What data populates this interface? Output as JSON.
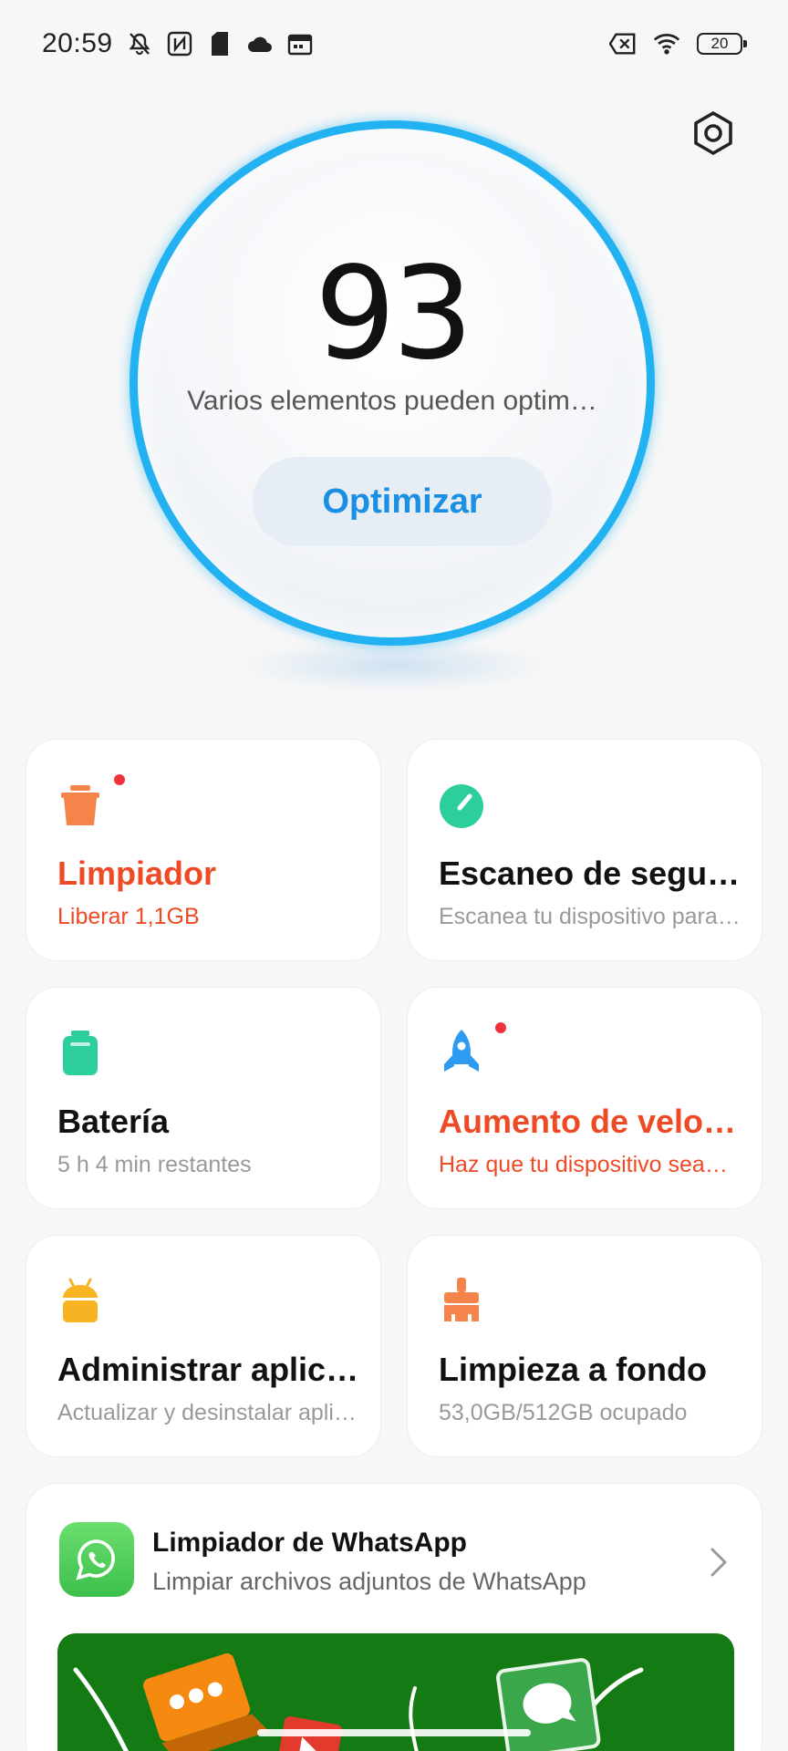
{
  "status_bar": {
    "time": "20:59",
    "battery_level": "20",
    "left_icons": [
      "mute-icon",
      "nfc-icon",
      "sim-icon",
      "cloud-icon",
      "calendar-icon"
    ],
    "right_icons": [
      "no-sim-icon",
      "wifi-icon",
      "battery-icon"
    ]
  },
  "score": {
    "value": "93",
    "subtitle": "Varios elementos pueden optim…",
    "optimize_label": "Optimizar",
    "ring_color": "#22b2f2"
  },
  "cards": [
    {
      "title": "Limpiador",
      "subtitle": "Liberar 1,1GB",
      "icon": "trash-icon",
      "icon_color": "#f5844a",
      "highlight": true,
      "dot": true
    },
    {
      "title": "Escaneo de seguri…",
      "subtitle": "Escanea tu dispositivo para…",
      "icon": "security-scan-icon",
      "icon_color": "#2ccf9c",
      "highlight": false,
      "dot": false
    },
    {
      "title": "Batería",
      "subtitle": "5 h 4 min  restantes",
      "icon": "battery-icon",
      "icon_color": "#2ccf9c",
      "highlight": false,
      "dot": false
    },
    {
      "title": "Aumento de veloci…",
      "subtitle": "Haz que tu dispositivo sea…",
      "icon": "rocket-icon",
      "icon_color": "#2f9bf0",
      "highlight": true,
      "dot": true
    },
    {
      "title": "Administrar aplica…",
      "subtitle": "Actualizar y desinstalar apli…",
      "icon": "android-icon",
      "icon_color": "#f7b321",
      "highlight": false,
      "dot": false
    },
    {
      "title": "Limpieza a fondo",
      "subtitle": "53,0GB/512GB ocupado",
      "icon": "broom-icon",
      "icon_color": "#f5844a",
      "highlight": false,
      "dot": false
    }
  ],
  "whatsapp": {
    "title": "Limpiador de WhatsApp",
    "subtitle": "Limpiar archivos adjuntos de WhatsApp",
    "icon": "whatsapp-icon"
  },
  "colors": {
    "accent_blue": "#1a8fe3",
    "alert_red": "#ee4a25",
    "banner_green": "#147a14"
  }
}
